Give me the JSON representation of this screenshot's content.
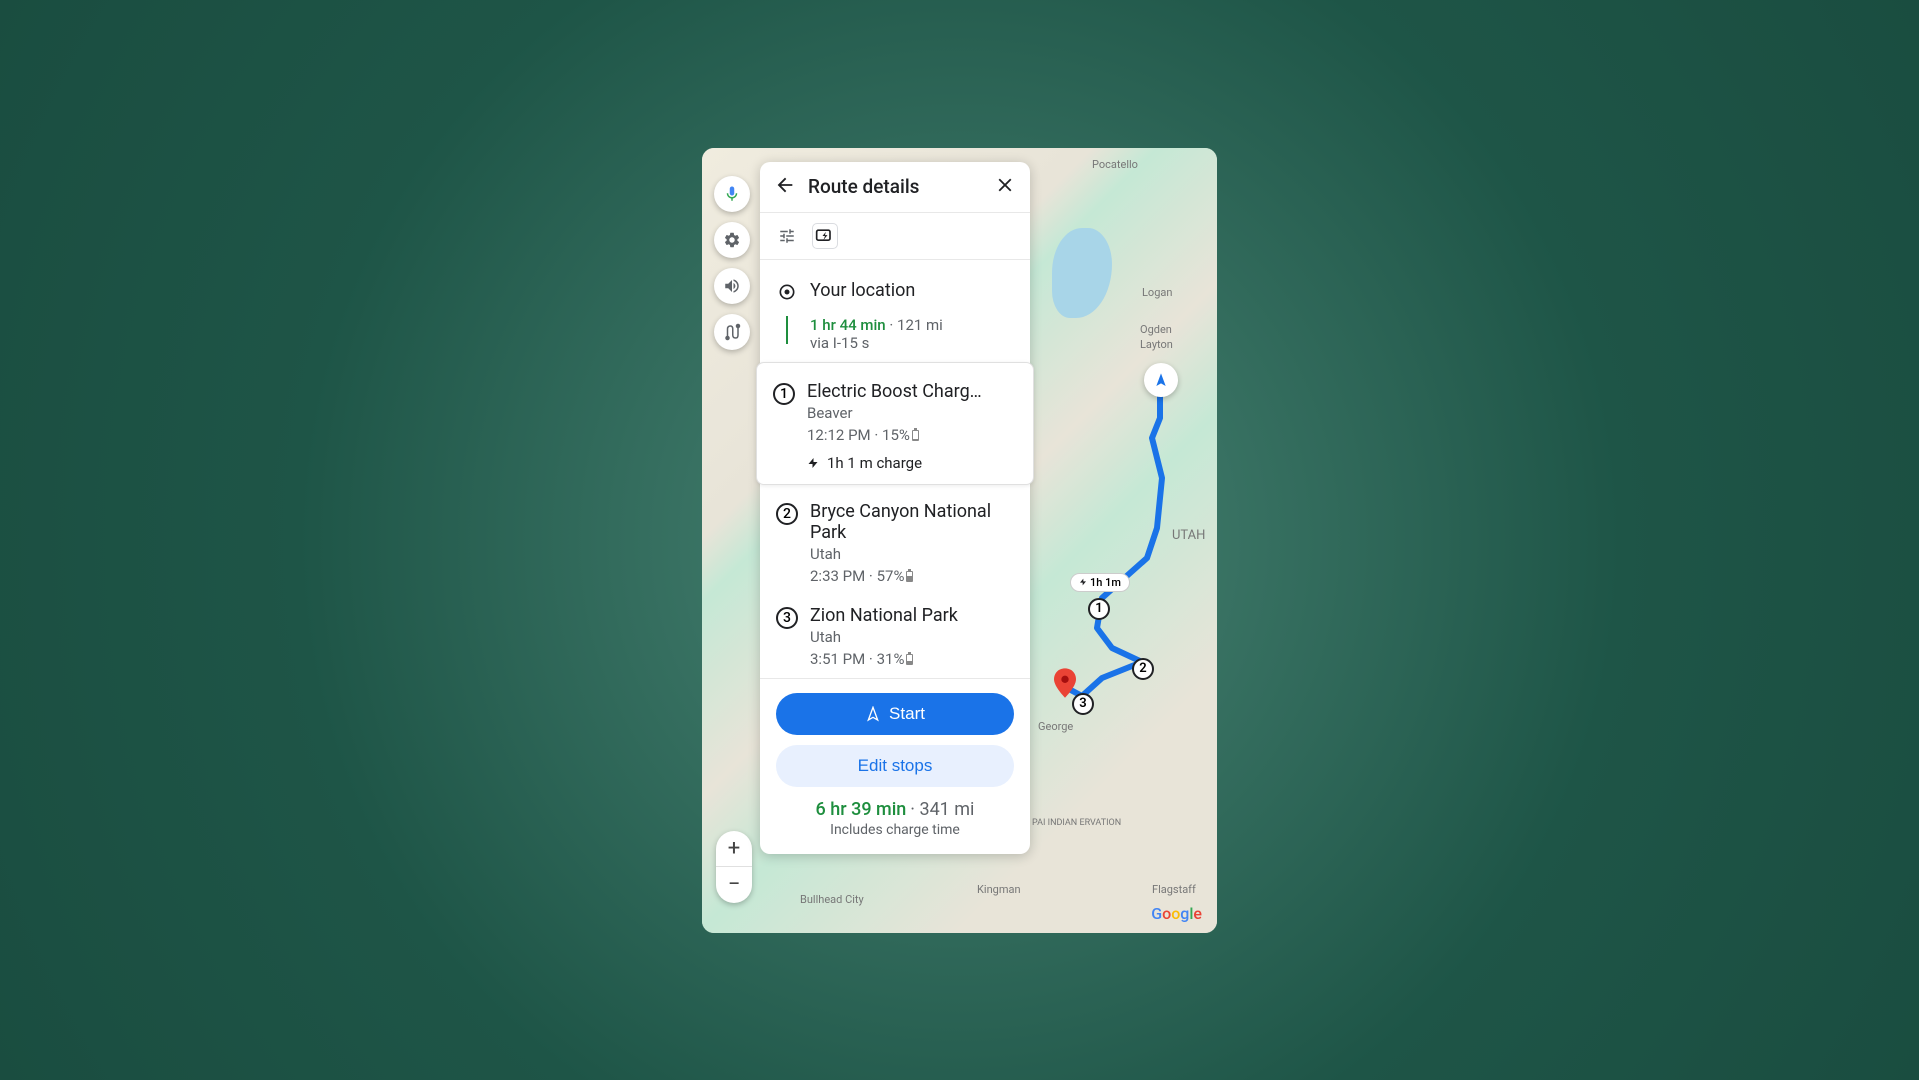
{
  "panel": {
    "title": "Route details",
    "start_location": "Your location",
    "leg": {
      "time": "1 hr 44 min",
      "distance": "121 mi",
      "via": "via I-15 s"
    },
    "stops": [
      {
        "num": "1",
        "title": "Electric Boost Charg…",
        "sub": "Beaver",
        "time": "12:12 PM",
        "battery": "15%",
        "charge": "1h 1 m charge"
      },
      {
        "num": "2",
        "title": "Bryce Canyon National Park",
        "sub": "Utah",
        "time": "2:33 PM",
        "battery": "57%"
      },
      {
        "num": "3",
        "title": "Zion National Park",
        "sub": "Utah",
        "time": "3:51 PM",
        "battery": "31%"
      }
    ],
    "start_btn": "Start",
    "edit_btn": "Edit stops",
    "summary_time": "6 hr 39 min",
    "summary_dist": "341 mi",
    "summary_note": "Includes charge time"
  },
  "map": {
    "charge_badge": "1h 1m",
    "labels": {
      "utah": "UTAH",
      "ogden": "Ogden",
      "layton": "Layton",
      "logan": "Logan",
      "pocatello": "Pocatello",
      "flagstaff": "Flagstaff",
      "kingman": "Kingman",
      "bullhead": "Bullhead City",
      "george": "George",
      "reservation": "PAI INDIAN ERVATION"
    }
  }
}
